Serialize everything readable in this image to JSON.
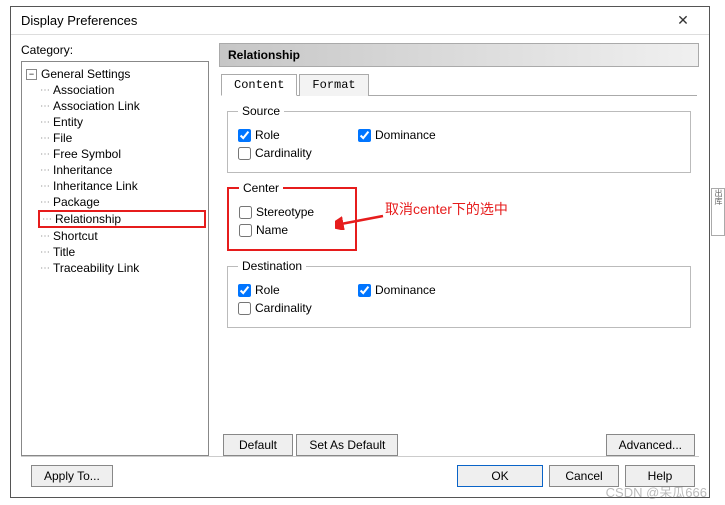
{
  "window": {
    "title": "Display Preferences",
    "close_glyph": "✕"
  },
  "category": {
    "label": "Category:",
    "root": "General Settings",
    "items": [
      "Association",
      "Association Link",
      "Entity",
      "File",
      "Free Symbol",
      "Inheritance",
      "Inheritance Link",
      "Package",
      "Relationship",
      "Shortcut",
      "Title",
      "Traceability Link"
    ],
    "selected_index": 8
  },
  "panel": {
    "header": "Relationship",
    "tabs": {
      "content": "Content",
      "format": "Format",
      "active": "content"
    },
    "groups": {
      "source": {
        "legend": "Source",
        "role": {
          "label": "Role",
          "checked": true
        },
        "dominance": {
          "label": "Dominance",
          "checked": true
        },
        "cardinality": {
          "label": "Cardinality",
          "checked": false
        }
      },
      "center": {
        "legend": "Center",
        "stereotype": {
          "label": "Stereotype",
          "checked": false
        },
        "name": {
          "label": "Name",
          "checked": false
        }
      },
      "destination": {
        "legend": "Destination",
        "role": {
          "label": "Role",
          "checked": true
        },
        "dominance": {
          "label": "Dominance",
          "checked": true
        },
        "cardinality": {
          "label": "Cardinality",
          "checked": false
        }
      }
    },
    "buttons": {
      "default": "Default",
      "set_as_default": "Set As Default",
      "advanced": "Advanced..."
    }
  },
  "footer": {
    "apply_to": "Apply To...",
    "ok": "OK",
    "cancel": "Cancel",
    "help": "Help"
  },
  "annotation": {
    "text": "取消center下的选中"
  },
  "watermark": "CSDN @呆瓜666",
  "bg_hint": "出库"
}
